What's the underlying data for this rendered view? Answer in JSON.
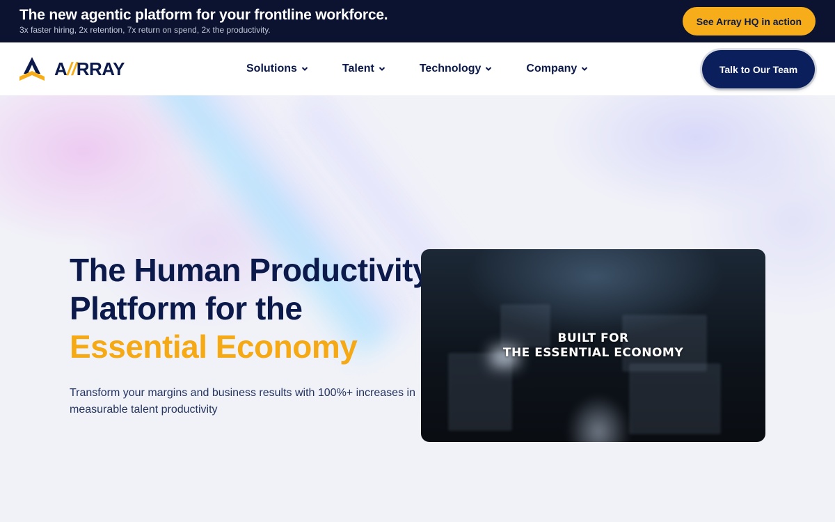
{
  "announcement": {
    "headline": "The new agentic platform for your frontline workforce.",
    "subtext": "3x faster hiring, 2x retention, 7x return on spend, 2x the productivity.",
    "cta_label": "See Array HQ in action"
  },
  "nav": {
    "logo_text_prefix": "A",
    "logo_slashes": "//",
    "logo_text_suffix": "RRAY",
    "items": [
      {
        "label": "Solutions"
      },
      {
        "label": "Talent"
      },
      {
        "label": "Technology"
      },
      {
        "label": "Company"
      }
    ],
    "cta_label": "Talk to Our Team"
  },
  "hero": {
    "title_line1": "The Human Productivity",
    "title_line2": "Platform for the",
    "title_accent": "Essential Economy",
    "subtitle": "Transform your margins and business results with 100%+ increases in measurable talent productivity"
  },
  "video": {
    "caption_line1": "BUILT FOR",
    "caption_line2": "THE ESSENTIAL ECONOMY"
  },
  "colors": {
    "navy": "#0b1a4a",
    "accent_yellow": "#f7ad19",
    "announcement_bg": "#0b1330",
    "nav_cta_bg": "#0b1f5c"
  },
  "icons": [
    "array-logo-icon",
    "chevron-down-icon"
  ]
}
